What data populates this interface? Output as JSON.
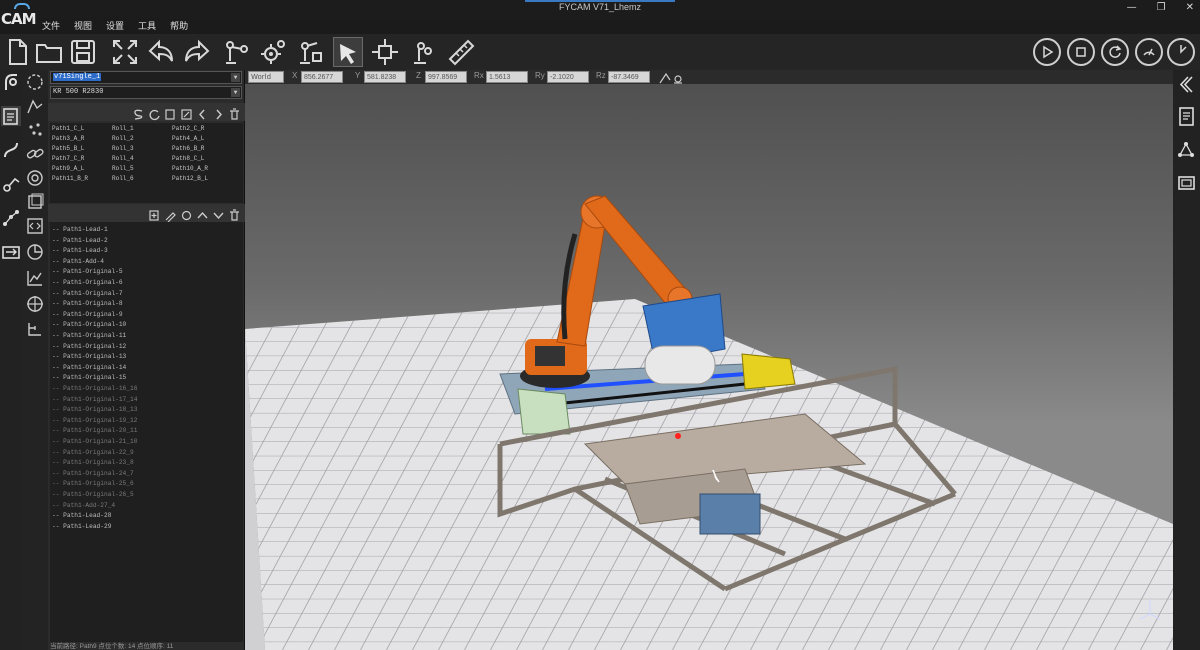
{
  "window": {
    "title": "FYCAM  V71_Lhemz",
    "logo_text": "CAM"
  },
  "menu": [
    "文件",
    "视图",
    "设置",
    "工具",
    "帮助"
  ],
  "toolbar_icons": [
    "new-file-icon",
    "open-folder-icon",
    "save-icon",
    "fit-view-icon",
    "undo-icon",
    "redo-icon",
    "robot-arm-icon",
    "gear-settings-icon",
    "robot-config-icon",
    "select-cursor-icon",
    "move-icon",
    "tool-icon",
    "ruler-icon"
  ],
  "sim_controls": [
    "play-icon",
    "stop-icon",
    "reset-icon",
    "speed-icon",
    "progress-icon"
  ],
  "coords": {
    "frame": "World",
    "fields": [
      {
        "label": "X",
        "value": "856.2677"
      },
      {
        "label": "Y",
        "value": "581.8238"
      },
      {
        "label": "Z",
        "value": "997.8569"
      },
      {
        "label": "Rx",
        "value": "1.5613"
      },
      {
        "label": "Ry",
        "value": "-2.1020"
      },
      {
        "label": "Rz",
        "value": "-87.3469"
      }
    ]
  },
  "left_panel": {
    "program": "v71Single_1",
    "robot": "KR 500 R2830",
    "path_grid": [
      [
        "Path1_C_L",
        "Roll_1",
        "Path2_C_R"
      ],
      [
        "Path3_A_R",
        "Roll_2",
        "Path4_A_L"
      ],
      [
        "Path5_B_L",
        "Roll_3",
        "Path6_B_R"
      ],
      [
        "Path7_C_R",
        "Roll_4",
        "Path8_C_L"
      ],
      [
        "Path9_A_L",
        "Roll_5",
        "Path10_A_R"
      ],
      [
        "Path11_B_R",
        "Roll_6",
        "Path12_B_L"
      ]
    ],
    "tree": [
      {
        "label": "-- Path1-Lead-1",
        "dim": false
      },
      {
        "label": "-- Path1-Lead-2",
        "dim": false
      },
      {
        "label": "-- Path1-Lead-3",
        "dim": false
      },
      {
        "label": "-- Path1-Add-4",
        "dim": false
      },
      {
        "label": "-- Path1-Original-5",
        "dim": false
      },
      {
        "label": "-- Path1-Original-6",
        "dim": false
      },
      {
        "label": "-- Path1-Original-7",
        "dim": false
      },
      {
        "label": "-- Path1-Original-8",
        "dim": false
      },
      {
        "label": "-- Path1-Original-9",
        "dim": false
      },
      {
        "label": "-- Path1-Original-10",
        "dim": false
      },
      {
        "label": "-- Path1-Original-11",
        "dim": false
      },
      {
        "label": "-- Path1-Original-12",
        "dim": false
      },
      {
        "label": "-- Path1-Original-13",
        "dim": false
      },
      {
        "label": "-- Path1-Original-14",
        "dim": false
      },
      {
        "label": "-- Path1-Original-15",
        "dim": false
      },
      {
        "label": "-- Path1-Original-16_16",
        "dim": true
      },
      {
        "label": "-- Path1-Original-17_14",
        "dim": true
      },
      {
        "label": "-- Path1-Original-18_13",
        "dim": true
      },
      {
        "label": "-- Path1-Original-19_12",
        "dim": true
      },
      {
        "label": "-- Path1-Original-20_11",
        "dim": true
      },
      {
        "label": "-- Path1-Original-21_10",
        "dim": true
      },
      {
        "label": "-- Path1-Original-22_9",
        "dim": true
      },
      {
        "label": "-- Path1-Original-23_8",
        "dim": true
      },
      {
        "label": "-- Path1-Original-24_7",
        "dim": true
      },
      {
        "label": "-- Path1-Original-25_6",
        "dim": true
      },
      {
        "label": "-- Path1-Original-26_5",
        "dim": true
      },
      {
        "label": "-- Path1-Add-27_4",
        "dim": true
      },
      {
        "label": "-- Path1-Lead-28",
        "dim": false
      },
      {
        "label": "-- Path1-Lead-29",
        "dim": false
      }
    ],
    "status": "当前路径: Path9   点位个数: 14   点位顺序: 11"
  },
  "colors": {
    "robot": "#e06a1a",
    "gripper": "#3a78c8",
    "frame": "#a89e92",
    "accent": "#2d6bc9"
  }
}
